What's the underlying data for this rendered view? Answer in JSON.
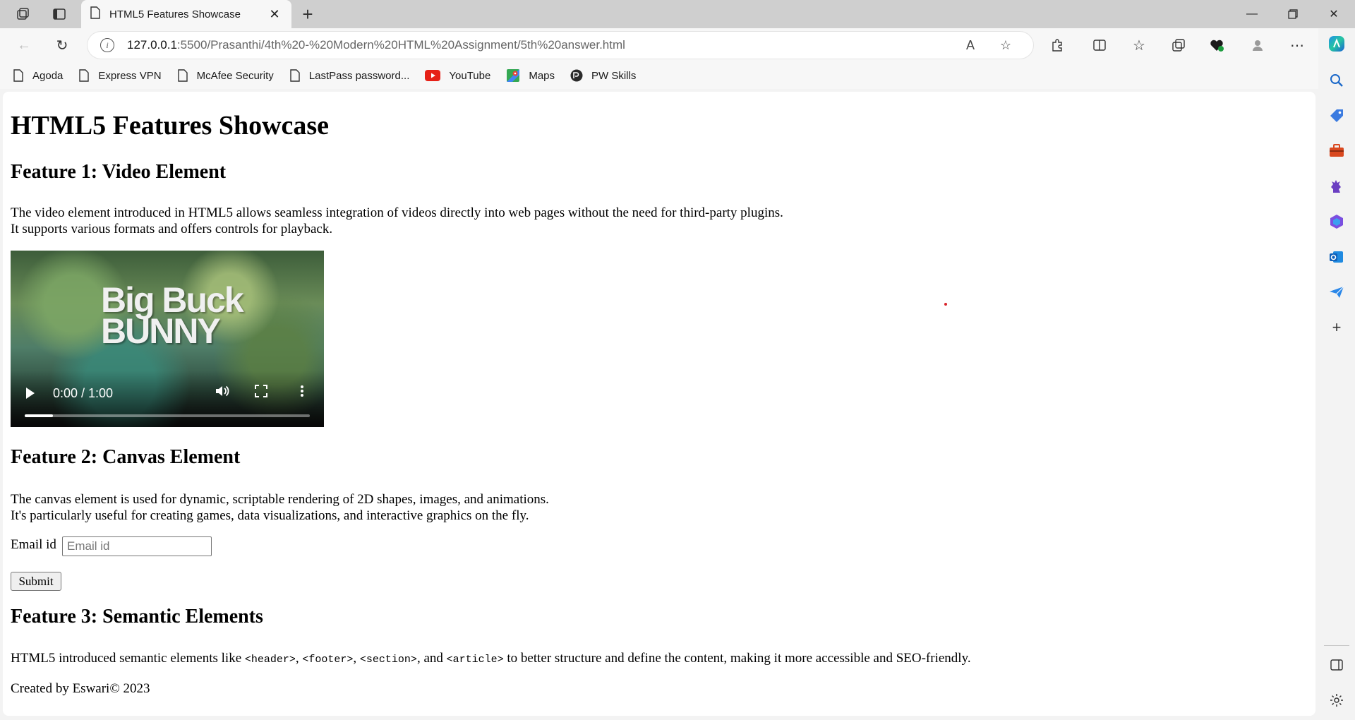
{
  "browser": {
    "tab": {
      "title": "HTML5 Features Showcase"
    },
    "address": {
      "host": "127.0.0.1",
      "rest": ":5500/Prasanthi/4th%20-%20Modern%20HTML%20Assignment/5th%20answer.html"
    },
    "bookmarks": [
      {
        "label": "Agoda",
        "icon": "page-icon"
      },
      {
        "label": "Express VPN",
        "icon": "page-icon"
      },
      {
        "label": "McAfee Security",
        "icon": "page-icon"
      },
      {
        "label": "LastPass password...",
        "icon": "page-icon"
      },
      {
        "label": "YouTube",
        "icon": "youtube-icon"
      },
      {
        "label": "Maps",
        "icon": "maps-icon"
      },
      {
        "label": "PW Skills",
        "icon": "pw-skills-icon"
      }
    ]
  },
  "page": {
    "title": "HTML5 Features Showcase",
    "feature1": {
      "heading": "Feature 1: Video Element",
      "line1": "The video element introduced in HTML5 allows seamless integration of videos directly into web pages without the need for third-party plugins.",
      "line2": "It supports various formats and offers controls for playback."
    },
    "video": {
      "poster_text": "Big Buck\nBUNNY",
      "time": "0:00 / 1:00",
      "progress": 0.1
    },
    "feature2": {
      "heading": "Feature 2: Canvas Element",
      "line1": "The canvas element is used for dynamic, scriptable rendering of 2D shapes, images, and animations.",
      "line2": "It's particularly useful for creating games, data visualizations, and interactive graphics on the fly."
    },
    "form": {
      "email_label": "Email id",
      "email_placeholder": "Email id",
      "email_value": "",
      "submit_label": "Submit"
    },
    "feature3": {
      "heading": "Feature 3: Semantic Elements",
      "text_before": "HTML5 introduced semantic elements like ",
      "tag_header": "<header>",
      "sep1": ", ",
      "tag_footer": "<footer>",
      "sep2": ", ",
      "tag_section": "<section>",
      "sep3": ", and ",
      "tag_article": "<article>",
      "text_after": " to better structure and define the content, making it more accessible and SEO-friendly."
    },
    "footer": "Created by Eswari© 2023"
  }
}
